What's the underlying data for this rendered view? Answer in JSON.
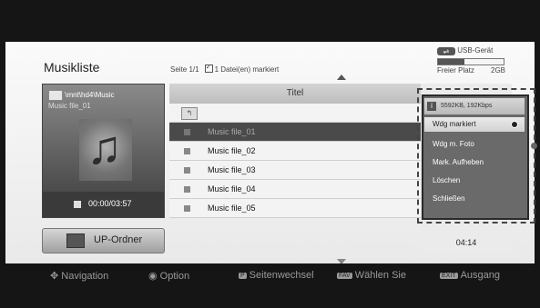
{
  "header": {
    "title": "Musikliste",
    "page": "Seite 1/1",
    "marked": "1 Datei(en) markiert"
  },
  "storage": {
    "device": "USB-Gerät",
    "free_label": "Freier Platz",
    "free_value": "2GB",
    "used_fraction": 0.4,
    "icon": "usb-icon"
  },
  "preview": {
    "path": "\\mnt\\hd4\\Music",
    "file": "Music file_01",
    "time": "00:00/03:57",
    "icons": [
      "folder-icon",
      "music-note-icon",
      "stop-icon"
    ]
  },
  "up_button": {
    "label": "UP-Ordner"
  },
  "list": {
    "column_title": "Titel",
    "rows": [
      {
        "name": ""
      },
      {
        "name": "Music file_01"
      },
      {
        "name": "Music file_02"
      },
      {
        "name": "Music file_03"
      },
      {
        "name": "Music file_04"
      },
      {
        "name": "Music file_05"
      }
    ],
    "duration": "04:14"
  },
  "popup": {
    "info": "5592KB, 192Kbps",
    "items": [
      {
        "label": "Wdg markiert"
      },
      {
        "label": "Wdg m. Foto"
      },
      {
        "label": "Mark. Aufheben"
      },
      {
        "label": "Löschen"
      },
      {
        "label": "Schließen"
      }
    ]
  },
  "footer": {
    "navigation": "Navigation",
    "option": "Option",
    "page_change": "Seitenwechsel",
    "select_key": "FAV",
    "select": "Wählen Sie",
    "exit_key": "EXIT",
    "exit": "Ausgang"
  }
}
